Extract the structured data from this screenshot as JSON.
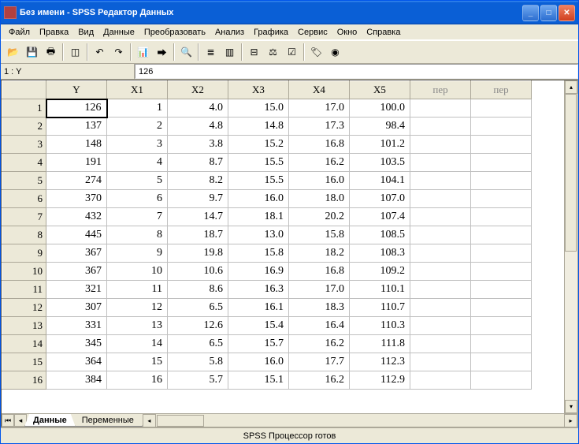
{
  "titlebar": {
    "title": "Без имени - SPSS Редактор Данных"
  },
  "menubar": [
    "Файл",
    "Правка",
    "Вид",
    "Данные",
    "Преобразовать",
    "Анализ",
    "Графика",
    "Сервис",
    "Окно",
    "Справка"
  ],
  "toolbar_icons": [
    "open-icon",
    "save-icon",
    "print-icon",
    "dialog-recall-icon",
    "undo-icon",
    "redo-icon",
    "goto-chart-icon",
    "goto-case-icon",
    "find-icon",
    "insert-case-icon",
    "insert-variable-icon",
    "split-file-icon",
    "weight-cases-icon",
    "select-cases-icon",
    "value-labels-icon",
    "use-sets-icon"
  ],
  "cellref": {
    "name": "1 : Y",
    "value": "126"
  },
  "columns": [
    "Y",
    "X1",
    "X2",
    "X3",
    "X4",
    "X5",
    "пер",
    "пер"
  ],
  "rows": [
    {
      "n": "1",
      "Y": "126",
      "X1": "1",
      "X2": "4.0",
      "X3": "15.0",
      "X4": "17.0",
      "X5": "100.0"
    },
    {
      "n": "2",
      "Y": "137",
      "X1": "2",
      "X2": "4.8",
      "X3": "14.8",
      "X4": "17.3",
      "X5": "98.4"
    },
    {
      "n": "3",
      "Y": "148",
      "X1": "3",
      "X2": "3.8",
      "X3": "15.2",
      "X4": "16.8",
      "X5": "101.2"
    },
    {
      "n": "4",
      "Y": "191",
      "X1": "4",
      "X2": "8.7",
      "X3": "15.5",
      "X4": "16.2",
      "X5": "103.5"
    },
    {
      "n": "5",
      "Y": "274",
      "X1": "5",
      "X2": "8.2",
      "X3": "15.5",
      "X4": "16.0",
      "X5": "104.1"
    },
    {
      "n": "6",
      "Y": "370",
      "X1": "6",
      "X2": "9.7",
      "X3": "16.0",
      "X4": "18.0",
      "X5": "107.0"
    },
    {
      "n": "7",
      "Y": "432",
      "X1": "7",
      "X2": "14.7",
      "X3": "18.1",
      "X4": "20.2",
      "X5": "107.4"
    },
    {
      "n": "8",
      "Y": "445",
      "X1": "8",
      "X2": "18.7",
      "X3": "13.0",
      "X4": "15.8",
      "X5": "108.5"
    },
    {
      "n": "9",
      "Y": "367",
      "X1": "9",
      "X2": "19.8",
      "X3": "15.8",
      "X4": "18.2",
      "X5": "108.3"
    },
    {
      "n": "10",
      "Y": "367",
      "X1": "10",
      "X2": "10.6",
      "X3": "16.9",
      "X4": "16.8",
      "X5": "109.2"
    },
    {
      "n": "11",
      "Y": "321",
      "X1": "11",
      "X2": "8.6",
      "X3": "16.3",
      "X4": "17.0",
      "X5": "110.1"
    },
    {
      "n": "12",
      "Y": "307",
      "X1": "12",
      "X2": "6.5",
      "X3": "16.1",
      "X4": "18.3",
      "X5": "110.7"
    },
    {
      "n": "13",
      "Y": "331",
      "X1": "13",
      "X2": "12.6",
      "X3": "15.4",
      "X4": "16.4",
      "X5": "110.3"
    },
    {
      "n": "14",
      "Y": "345",
      "X1": "14",
      "X2": "6.5",
      "X3": "15.7",
      "X4": "16.2",
      "X5": "111.8"
    },
    {
      "n": "15",
      "Y": "364",
      "X1": "15",
      "X2": "5.8",
      "X3": "16.0",
      "X4": "17.7",
      "X5": "112.3"
    },
    {
      "n": "16",
      "Y": "384",
      "X1": "16",
      "X2": "5.7",
      "X3": "15.1",
      "X4": "16.2",
      "X5": "112.9"
    }
  ],
  "tabs": {
    "active": "Данные",
    "inactive": "Переменные"
  },
  "statusbar": "SPSS Процессор готов"
}
